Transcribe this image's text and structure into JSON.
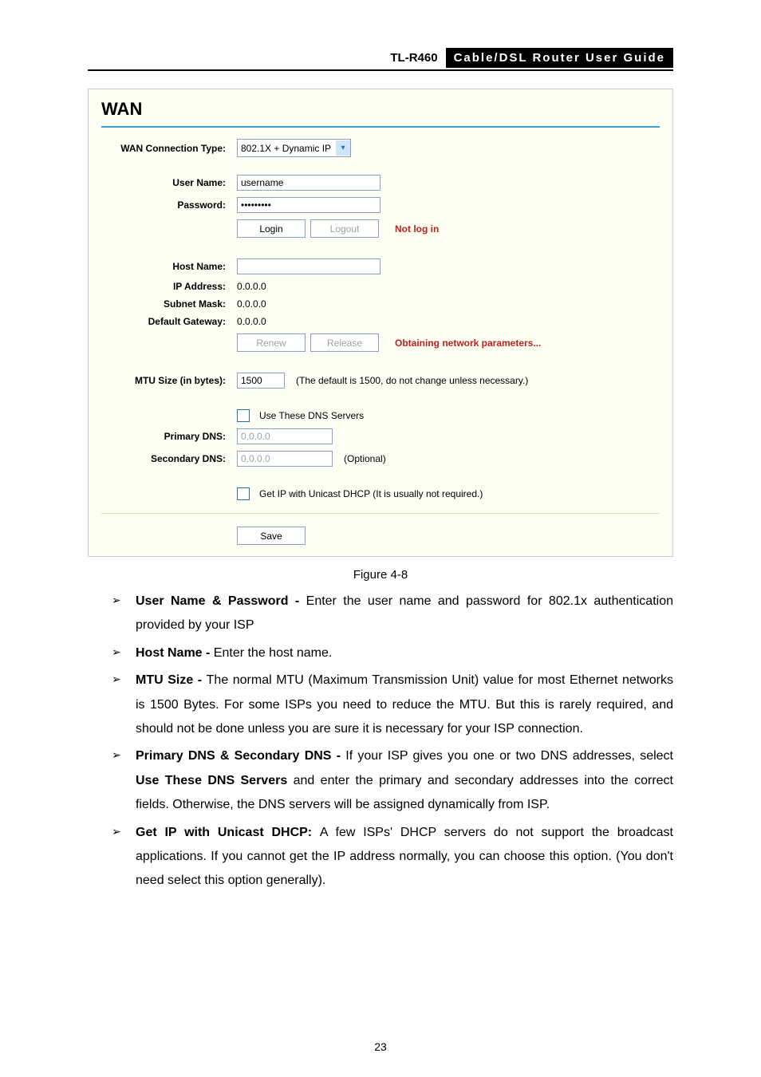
{
  "header": {
    "model": "TL-R460",
    "title": "Cable/DSL  Router  User  Guide"
  },
  "panel": {
    "heading": "WAN",
    "connType": {
      "label": "WAN Connection Type:",
      "value": "802.1X + Dynamic IP"
    },
    "user": {
      "label": "User Name:",
      "value": "username"
    },
    "pass": {
      "label": "Password:",
      "value": "•••••••••"
    },
    "loginBtn": "Login",
    "logoutBtn": "Logout",
    "loginStatus": "Not log in",
    "host": {
      "label": "Host Name:",
      "value": ""
    },
    "ip": {
      "label": "IP Address:",
      "value": "0.0.0.0"
    },
    "mask": {
      "label": "Subnet Mask:",
      "value": "0.0.0.0"
    },
    "gw": {
      "label": "Default Gateway:",
      "value": "0.0.0.0"
    },
    "renewBtn": "Renew",
    "releaseBtn": "Release",
    "dhcpStatus": "Obtaining network parameters...",
    "mtu": {
      "label": "MTU Size (in bytes):",
      "value": "1500",
      "hint": "(The default is 1500, do not change unless necessary.)"
    },
    "useDns": "Use These DNS Servers",
    "pdns": {
      "label": "Primary DNS:",
      "value": "0.0.0.0"
    },
    "sdns": {
      "label": "Secondary DNS:",
      "value": "0.0.0.0",
      "hint": "(Optional)"
    },
    "unicast": "Get IP with Unicast DHCP (It is usually not required.)",
    "saveBtn": "Save"
  },
  "figcap": "Figure 4-8",
  "bullets": [
    {
      "bold": "User Name & Password - ",
      "text": "Enter the user name and password for 802.1x authentication provided by your ISP"
    },
    {
      "bold": "Host Name - ",
      "text": "Enter the host name."
    },
    {
      "bold": "MTU Size - ",
      "text": "The normal MTU (Maximum Transmission Unit) value for most Ethernet networks is 1500 Bytes. For some ISPs you need to reduce the MTU. But this is rarely required, and should not be done unless you are sure it is necessary for your ISP connection."
    },
    {
      "bold": "Primary DNS & Secondary DNS - ",
      "text": "If your ISP gives you one or two DNS addresses, select <b>Use These DNS Servers</b> and enter the primary and secondary addresses into the correct fields. Otherwise, the DNS servers will be assigned dynamically from ISP."
    },
    {
      "bold": "Get IP with Unicast DHCP: ",
      "text": "A few ISPs' DHCP servers do not support the broadcast applications. If you cannot get the IP address normally, you can choose this option. (You don't need select this option generally)."
    }
  ],
  "pageNumber": "23"
}
